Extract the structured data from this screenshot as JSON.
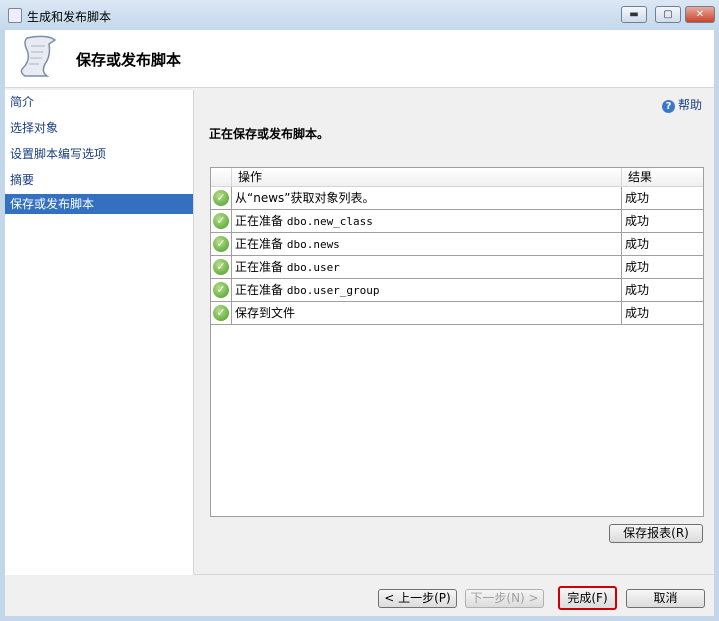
{
  "window": {
    "title": "生成和发布脚本",
    "minimize": "▬",
    "maximize": "▢",
    "close": "✕"
  },
  "header": {
    "title": "保存或发布脚本"
  },
  "nav": {
    "items": [
      {
        "label": "简介"
      },
      {
        "label": "选择对象"
      },
      {
        "label": "设置脚本编写选项"
      },
      {
        "label": "摘要"
      },
      {
        "label": "保存或发布脚本",
        "selected": true
      }
    ]
  },
  "help": {
    "label": "帮助"
  },
  "status": "正在保存或发布脚本。",
  "table": {
    "columns": [
      "操作",
      "结果"
    ],
    "rows": [
      {
        "action": "从“news”获取对象列表。",
        "result": "成功"
      },
      {
        "action": "正在准备 dbo.new_class",
        "result": "成功"
      },
      {
        "action": "正在准备 dbo.news",
        "result": "成功"
      },
      {
        "action": "正在准备 dbo.user",
        "result": "成功"
      },
      {
        "action": "正在准备 dbo.user_group",
        "result": "成功"
      },
      {
        "action": "保存到文件",
        "result": "成功"
      }
    ]
  },
  "buttons": {
    "save_report": "保存报表(R)",
    "previous": "< 上一步(P)",
    "next": "下一步(N) >",
    "finish": "完成(F)",
    "cancel": "取消"
  }
}
